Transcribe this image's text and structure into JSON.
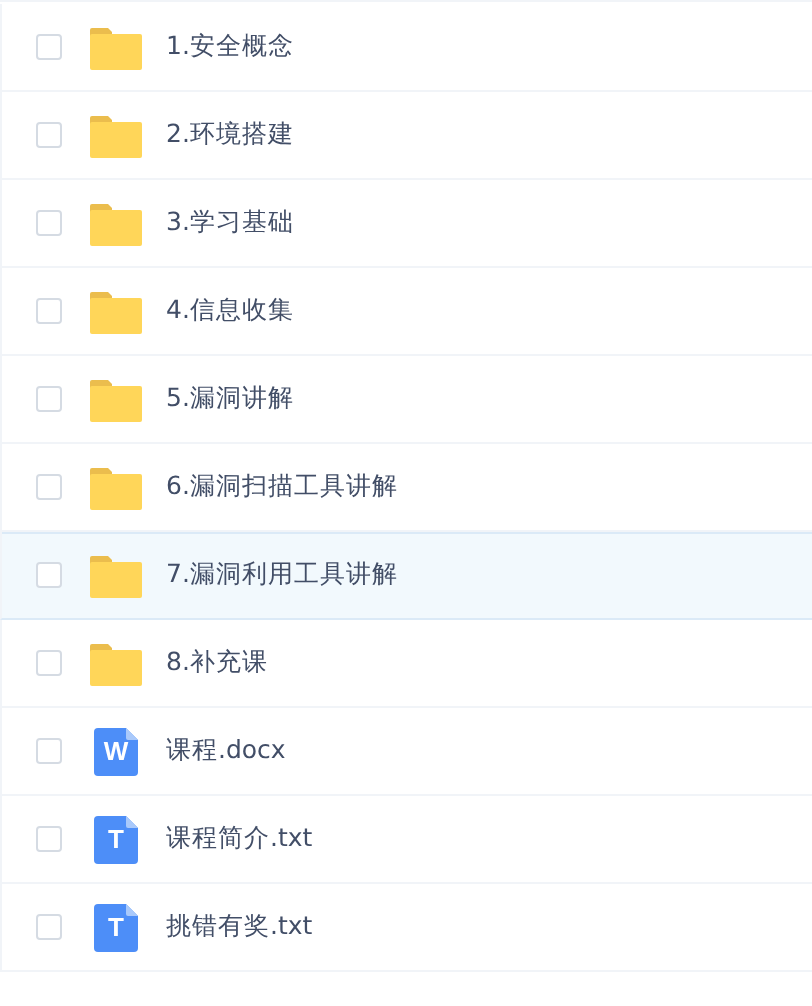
{
  "files": [
    {
      "kind": "folder",
      "name": "1.安全概念",
      "selected": false,
      "checked": false
    },
    {
      "kind": "folder",
      "name": "2.环境搭建",
      "selected": false,
      "checked": false
    },
    {
      "kind": "folder",
      "name": "3.学习基础",
      "selected": false,
      "checked": false
    },
    {
      "kind": "folder",
      "name": "4.信息收集",
      "selected": false,
      "checked": false
    },
    {
      "kind": "folder",
      "name": "5.漏洞讲解",
      "selected": false,
      "checked": false
    },
    {
      "kind": "folder",
      "name": "6.漏洞扫描工具讲解",
      "selected": false,
      "checked": false
    },
    {
      "kind": "folder",
      "name": "7.漏洞利用工具讲解",
      "selected": true,
      "checked": false
    },
    {
      "kind": "folder",
      "name": "8.补充课",
      "selected": false,
      "checked": false
    },
    {
      "kind": "document",
      "icon_letter": "W",
      "name": "课程.docx",
      "selected": false,
      "checked": false
    },
    {
      "kind": "document",
      "icon_letter": "T",
      "name": "课程简介.txt",
      "selected": false,
      "checked": false
    },
    {
      "kind": "document",
      "icon_letter": "T",
      "name": "挑错有奖.txt",
      "selected": false,
      "checked": false
    }
  ]
}
